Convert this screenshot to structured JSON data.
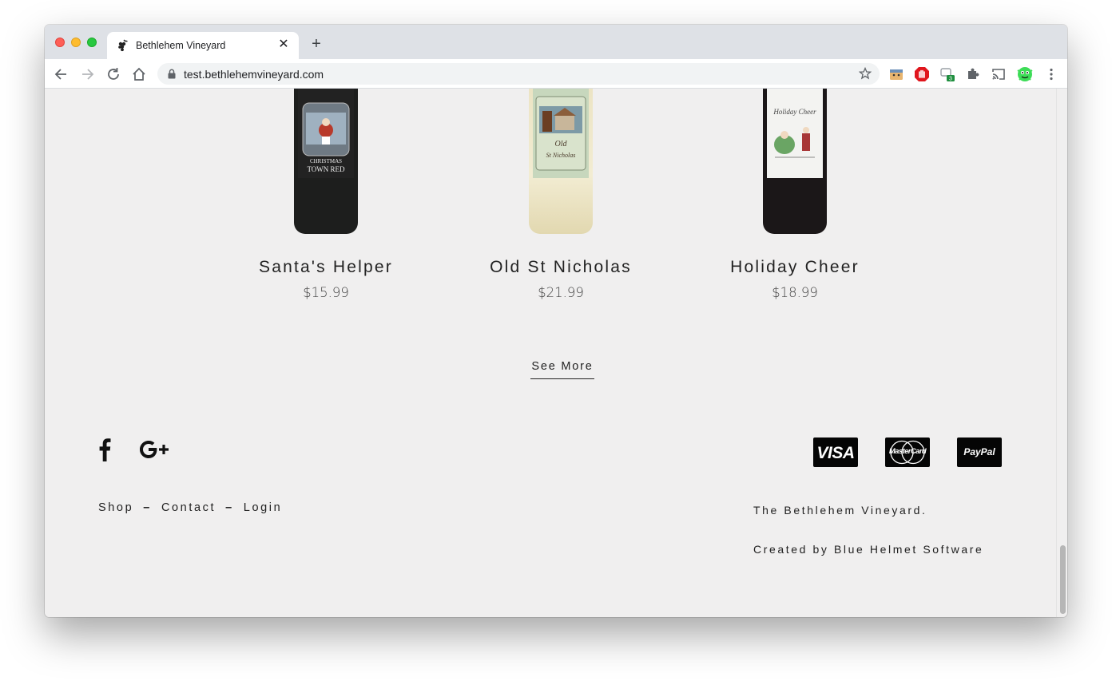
{
  "browser": {
    "tab_title": "Bethlehem Vineyard",
    "tab_close": "✕",
    "new_tab": "+",
    "url": "test.bethlehemvineyard.com",
    "extension_badge": "3"
  },
  "products": [
    {
      "name": "Santa's Helper",
      "price": "$15.99",
      "bottle_color": "#1c1d1c",
      "label_top": "CHRISTMAS",
      "label_bottom": "TOWN RED"
    },
    {
      "name": "Old St Nicholas",
      "price": "$21.99",
      "bottle_color": "#e6ddb4",
      "label_top": "Old",
      "label_bottom": "St Nicholas"
    },
    {
      "name": "Holiday Cheer",
      "price": "$18.99",
      "bottle_color": "#1b1718",
      "label_top": "Holiday Cheer",
      "label_bottom": ""
    }
  ],
  "see_more": "See More",
  "footer": {
    "social": [
      "facebook-icon",
      "google-plus-icon"
    ],
    "links": [
      "Shop",
      "Contact",
      "Login"
    ],
    "separator": "–",
    "payments": [
      "VISA",
      "MasterCard",
      "PayPal"
    ],
    "company": "The Bethlehem Vineyard.",
    "credit": "Created by Blue Helmet Software"
  }
}
